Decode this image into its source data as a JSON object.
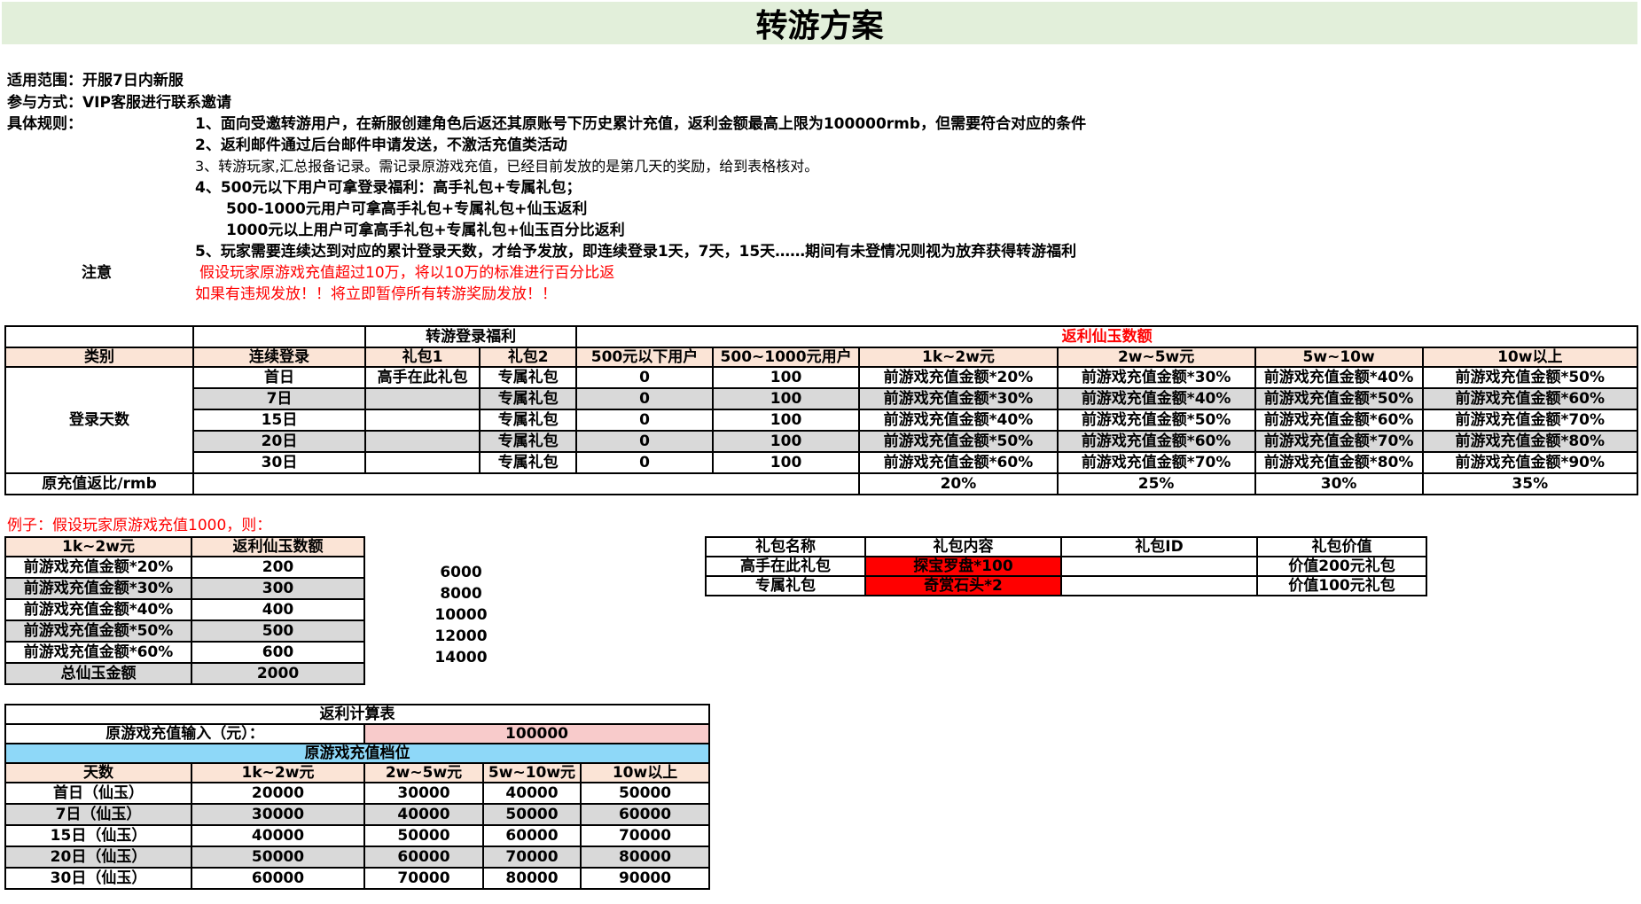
{
  "title": "转游方案",
  "rules": {
    "scope": "适用范围：开服7日内新服",
    "method": "参与方式：VIP客服进行联系邀请",
    "rules_label": "具体规则：",
    "rule1": "1、面向受邀转游用户，在新服创建角色后返还其原账号下历史累计充值，返利金额最高上限为100000rmb，但需要符合对应的条件",
    "rule2": "2、返利邮件通过后台邮件申请发送，不激活充值类活动",
    "rule3": "3、转游玩家,汇总报备记录。需记录原游戏充值，已经目前发放的是第几天的奖励，给到表格核对。",
    "rule4a": "4、500元以下用户可拿登录福利：高手礼包+专属礼包；",
    "rule4b": "500-1000元用户可拿高手礼包+专属礼包+仙玉返利",
    "rule4c": "1000元以上用户可拿高手礼包+专属礼包+仙玉百分比返利",
    "rule5": "5、玩家需要连续达到对应的累计登录天数，才给予发放，即连续登录1天，7天，15天……期间有未登情况则视为放弃获得转游福利",
    "note_label": "注意",
    "note1": "假设玩家原游戏充值超过10万，将以10万的标准进行百分比返",
    "note2": "如果有违规发放！！将立即暂停所有转游奖励发放！！"
  },
  "main_table": {
    "header_login": "转游登录福利",
    "header_rebate": "返利仙玉数额",
    "cols": [
      "类别",
      "连续登录",
      "礼包1",
      "礼包2",
      "500元以下用户",
      "500~1000元用户",
      "1k~2w元",
      "2w~5w元",
      "5w~10w",
      "10w以上"
    ],
    "row_group_label": "登录天数",
    "rows": [
      {
        "day": "首日",
        "g1": "高手在此礼包",
        "g2": "专属礼包",
        "u500": "0",
        "u1000": "100",
        "r1": "前游戏充值金额*20%",
        "r2": "前游戏充值金额*30%",
        "r3": "前游戏充值金额*40%",
        "r4": "前游戏充值金额*50%"
      },
      {
        "day": "7日",
        "g1": "",
        "g2": "专属礼包",
        "u500": "0",
        "u1000": "100",
        "r1": "前游戏充值金额*30%",
        "r2": "前游戏充值金额*40%",
        "r3": "前游戏充值金额*50%",
        "r4": "前游戏充值金额*60%"
      },
      {
        "day": "15日",
        "g1": "",
        "g2": "专属礼包",
        "u500": "0",
        "u1000": "100",
        "r1": "前游戏充值金额*40%",
        "r2": "前游戏充值金额*50%",
        "r3": "前游戏充值金额*60%",
        "r4": "前游戏充值金额*70%"
      },
      {
        "day": "20日",
        "g1": "",
        "g2": "专属礼包",
        "u500": "0",
        "u1000": "100",
        "r1": "前游戏充值金额*50%",
        "r2": "前游戏充值金额*60%",
        "r3": "前游戏充值金额*70%",
        "r4": "前游戏充值金额*80%"
      },
      {
        "day": "30日",
        "g1": "",
        "g2": "专属礼包",
        "u500": "0",
        "u1000": "100",
        "r1": "前游戏充值金额*60%",
        "r2": "前游戏充值金额*70%",
        "r3": "前游戏充值金额*80%",
        "r4": "前游戏充值金额*90%"
      }
    ],
    "footer_label": "原充值返比/rmb",
    "footer_values": [
      "20%",
      "25%",
      "30%",
      "35%"
    ]
  },
  "example": {
    "label": "例子：假设玩家原游戏充值1000，则：",
    "cols": [
      "1k~2w元",
      "返利仙玉数额"
    ],
    "rows": [
      {
        "formula": "前游戏充值金额*20%",
        "value": "200"
      },
      {
        "formula": "前游戏充值金额*30%",
        "value": "300"
      },
      {
        "formula": "前游戏充值金额*40%",
        "value": "400"
      },
      {
        "formula": "前游戏充值金额*50%",
        "value": "500"
      },
      {
        "formula": "前游戏充值金额*60%",
        "value": "600"
      }
    ],
    "total_label": "总仙玉金额",
    "total_value": "2000",
    "side_values": [
      "6000",
      "8000",
      "10000",
      "12000",
      "14000"
    ]
  },
  "gifts": {
    "cols": [
      "礼包名称",
      "礼包内容",
      "礼包ID",
      "礼包价值"
    ],
    "rows": [
      {
        "name": "高手在此礼包",
        "content": "探宝罗盘*100",
        "id": "",
        "value": "价值200元礼包"
      },
      {
        "name": "专属礼包",
        "content": "奇赏石头*2",
        "id": "",
        "value": "价值100元礼包"
      }
    ]
  },
  "calc": {
    "title": "返利计算表",
    "input_label": "原游戏充值输入（元）：",
    "input_value": "100000",
    "tier_label": "原游戏充值档位",
    "cols": [
      "天数",
      "1k~2w元",
      "2w~5w元",
      "5w~10w元",
      "10w以上"
    ],
    "rows": [
      {
        "day": "首日（仙玉）",
        "v": [
          "20000",
          "30000",
          "40000",
          "50000"
        ]
      },
      {
        "day": "7日（仙玉）",
        "v": [
          "30000",
          "40000",
          "50000",
          "60000"
        ]
      },
      {
        "day": "15日（仙玉）",
        "v": [
          "40000",
          "50000",
          "60000",
          "70000"
        ]
      },
      {
        "day": "20日（仙玉）",
        "v": [
          "50000",
          "60000",
          "70000",
          "80000"
        ]
      },
      {
        "day": "30日（仙玉）",
        "v": [
          "60000",
          "70000",
          "80000",
          "90000"
        ]
      }
    ]
  }
}
